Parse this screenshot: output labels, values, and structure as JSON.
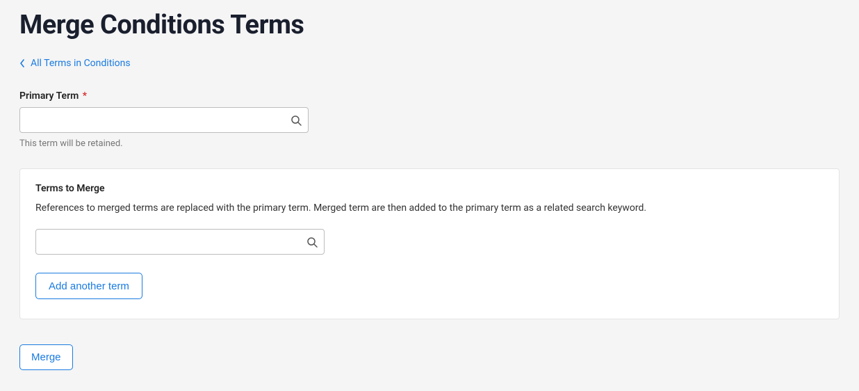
{
  "page": {
    "title": "Merge Conditions Terms"
  },
  "breadcrumb": {
    "label": "All Terms in Conditions"
  },
  "primaryTerm": {
    "label": "Primary Term",
    "required_marker": "*",
    "value": "",
    "helper": "This term will be retained."
  },
  "termsToMerge": {
    "title": "Terms to Merge",
    "description": "References to merged terms are replaced with the primary term. Merged term are then added to the primary term as a related search keyword.",
    "inputValue": "",
    "addButton": "Add another term"
  },
  "actions": {
    "merge": "Merge"
  }
}
